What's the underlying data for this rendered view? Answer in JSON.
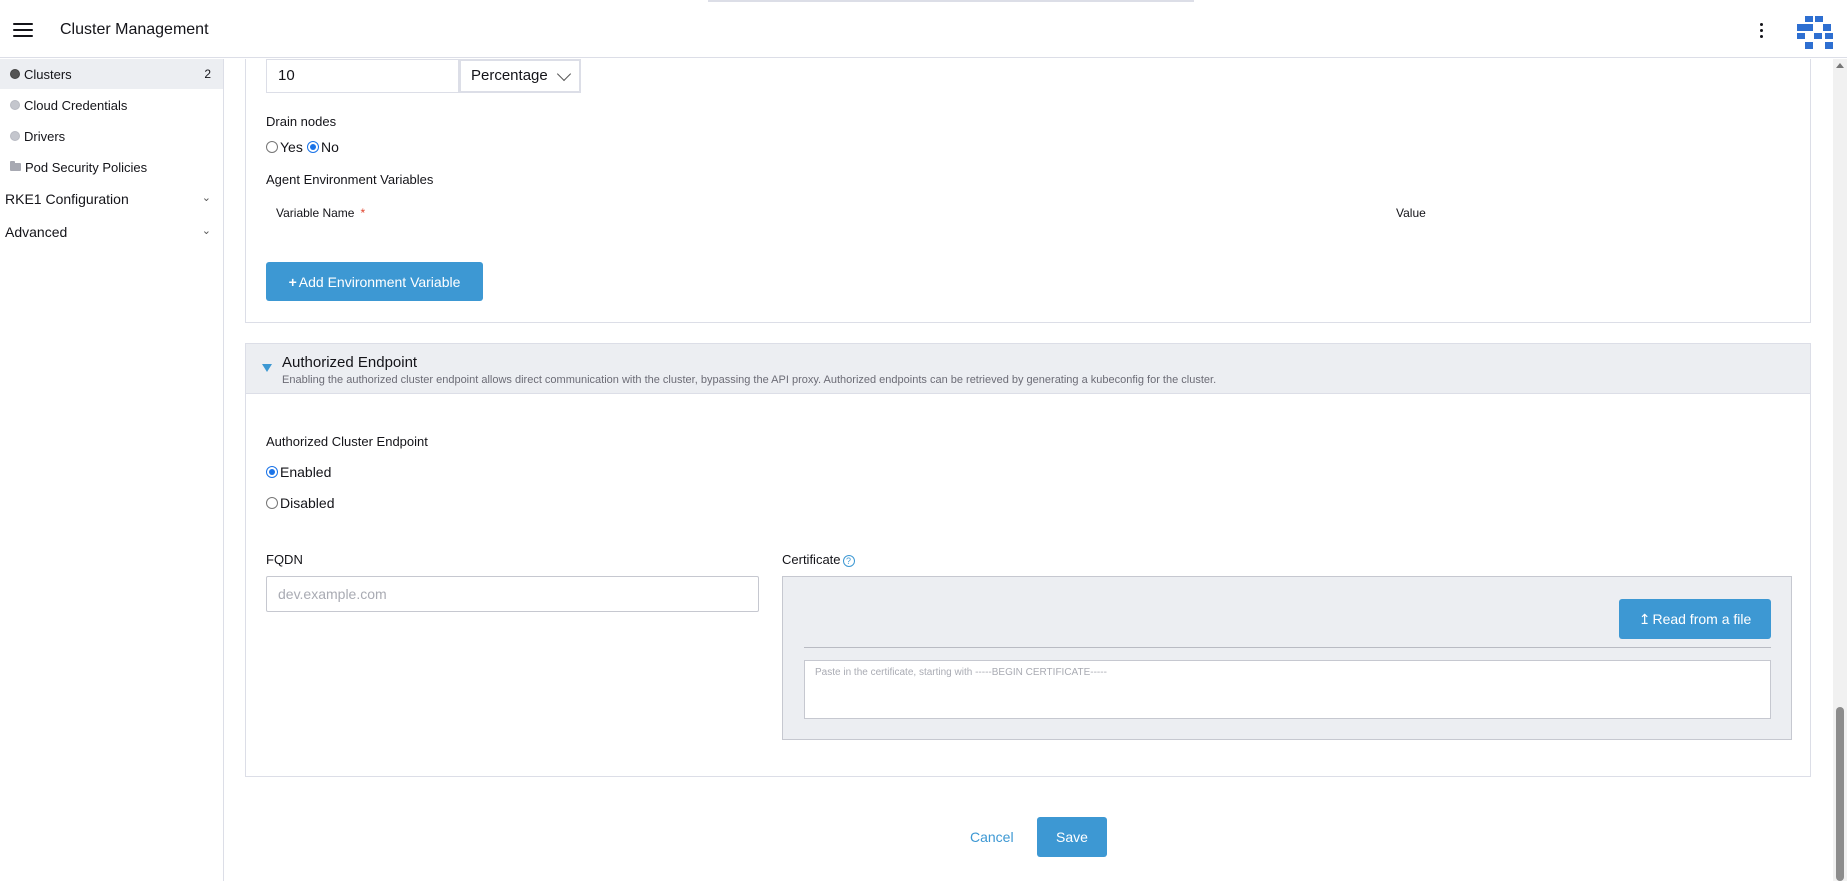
{
  "header": {
    "title": "Cluster Management",
    "menu_icon": "hamburger-icon",
    "more_icon": "kebab-icon",
    "logo_icon": "rancher-logo"
  },
  "sidebar": {
    "items": [
      {
        "label": "Clusters",
        "count": "2",
        "icon": "cluster-dot-icon",
        "active": true
      },
      {
        "label": "Cloud Credentials",
        "icon": "dot-icon"
      },
      {
        "label": "Drivers",
        "icon": "dot-icon"
      },
      {
        "label": "Pod Security Policies",
        "icon": "folder-icon"
      }
    ],
    "groups": [
      {
        "label": "RKE1 Configuration",
        "icon": "chevron-down-icon"
      },
      {
        "label": "Advanced",
        "icon": "chevron-down-icon"
      }
    ]
  },
  "upgrade": {
    "value": "10",
    "unit": "Percentage"
  },
  "drain": {
    "label": "Drain nodes",
    "yes": "Yes",
    "no": "No",
    "selected": "No"
  },
  "env": {
    "label": "Agent Environment Variables",
    "col_name": "Variable Name",
    "required_mark": "*",
    "col_value": "Value",
    "add_button": "Add Environment Variable"
  },
  "endpoint": {
    "title": "Authorized Endpoint",
    "description": "Enabling the authorized cluster endpoint allows direct communication with the cluster, bypassing the API proxy. Authorized endpoints can be retrieved by generating a kubeconfig for the cluster.",
    "ace_label": "Authorized Cluster Endpoint",
    "enabled": "Enabled",
    "disabled": "Disabled",
    "selected": "Enabled",
    "fqdn_label": "FQDN",
    "fqdn_placeholder": "dev.example.com",
    "cert_label": "Certificate",
    "help_icon": "?",
    "read_file": "Read from a file",
    "cert_placeholder": "Paste in the certificate, starting with -----BEGIN CERTIFICATE-----"
  },
  "footer": {
    "cancel": "Cancel",
    "save": "Save"
  },
  "colors": {
    "accent": "#3d98d3",
    "radio": "#1a73e8",
    "required": "#e0442e"
  }
}
